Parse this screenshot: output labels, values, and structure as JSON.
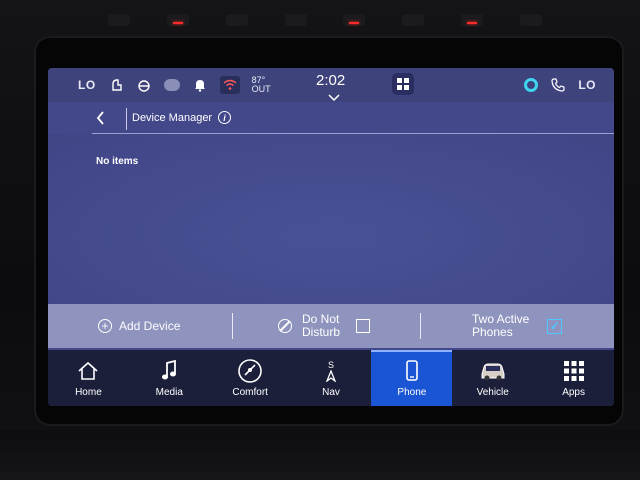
{
  "status_bar": {
    "left_temp": "LO",
    "outside_temp": "87°",
    "outside_label": "OUT",
    "time": "2:02",
    "right_temp": "LO"
  },
  "header": {
    "title": "Device Manager",
    "info_glyph": "i"
  },
  "content": {
    "empty_message": "No items"
  },
  "actions": {
    "add_device": "Add Device",
    "do_not_disturb_line1": "Do Not",
    "do_not_disturb_line2": "Disturb",
    "do_not_disturb_checked": false,
    "two_active_line1": "Two Active",
    "two_active_line2": "Phones",
    "two_active_checked": true
  },
  "nav": {
    "items": [
      {
        "label": "Home",
        "icon": "home-icon"
      },
      {
        "label": "Media",
        "icon": "music-note-icon"
      },
      {
        "label": "Comfort",
        "icon": "comfort-gauge-icon"
      },
      {
        "label": "Nav",
        "icon": "compass-icon"
      },
      {
        "label": "Phone",
        "icon": "phone-icon",
        "active": true
      },
      {
        "label": "Vehicle",
        "icon": "car-icon"
      },
      {
        "label": "Apps",
        "icon": "apps-grid-icon"
      }
    ],
    "compass_heading": "S"
  },
  "colors": {
    "active_tab": "#1a55d6",
    "accent_check": "#4ec6ff",
    "alexa": "#3fd4f0"
  }
}
